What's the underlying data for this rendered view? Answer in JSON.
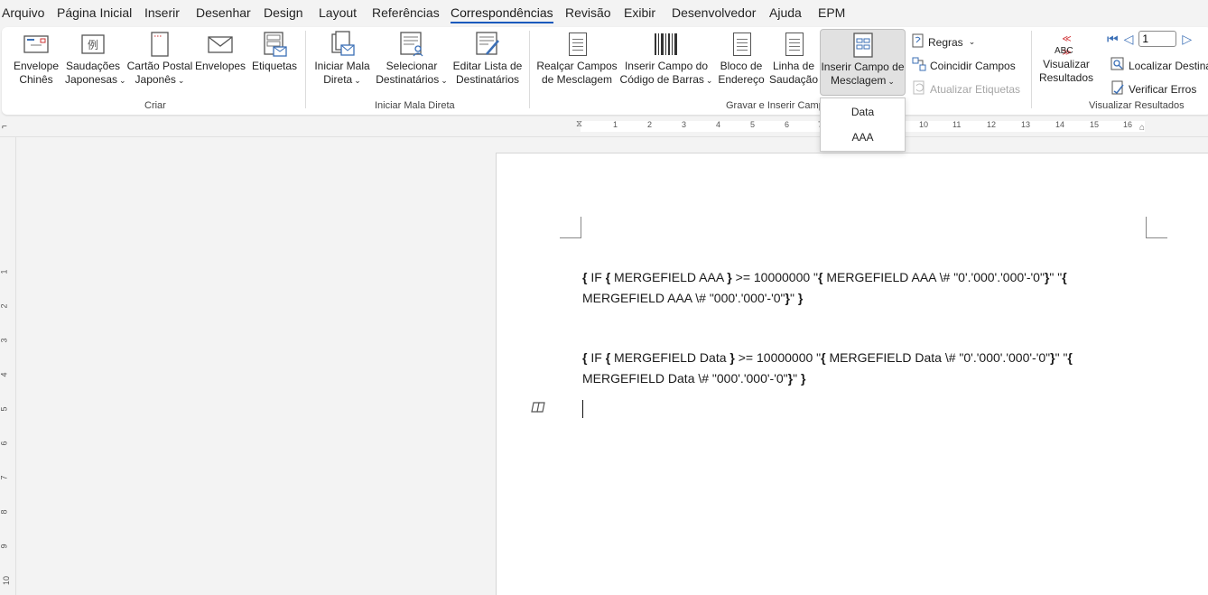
{
  "tabs": [
    "Arquivo",
    "Página Inicial",
    "Inserir",
    "Desenhar",
    "Design",
    "Layout",
    "Referências",
    "Correspondências",
    "Revisão",
    "Exibir",
    "Desenvolvedor",
    "Ajuda",
    "EPM"
  ],
  "active_tab": "Correspondências",
  "ribbon": {
    "criar": {
      "group_label": "Criar",
      "envelope_chines": [
        "Envelope",
        "Chinês"
      ],
      "saudacoes": [
        "Saudações",
        "Japonesas"
      ],
      "cartao": [
        "Cartão Postal",
        "Japonês"
      ],
      "envelopes": "Envelopes",
      "etiquetas": "Etiquetas"
    },
    "iniciar": {
      "group_label": "Iniciar Mala Direta",
      "iniciar_mala": [
        "Iniciar Mala",
        "Direta"
      ],
      "selecionar": [
        "Selecionar",
        "Destinatários"
      ],
      "editar": [
        "Editar Lista de",
        "Destinatários"
      ]
    },
    "gravar": {
      "group_label": "Gravar e Inserir Camp",
      "realcar": [
        "Realçar Campos",
        "de Mesclagem"
      ],
      "codigo_barras": [
        "Inserir Campo do",
        "Código de Barras"
      ],
      "bloco": [
        "Bloco de",
        "Endereço"
      ],
      "linha": [
        "Linha de",
        "Saudação"
      ],
      "inserir_campo": [
        "Inserir Campo de",
        "Mesclagem"
      ],
      "regras": "Regras",
      "coincidir": "Coincidir Campos",
      "atualizar": "Atualizar Etiquetas"
    },
    "visualizar": {
      "group_label": "Visualizar Resultados",
      "abc": "ABC",
      "visualizar": [
        "Visualizar",
        "Resultados"
      ],
      "record_value": "1",
      "localizar": "Localizar Destina",
      "verificar": "Verificar Erros"
    }
  },
  "merge_dropdown": [
    "Data",
    "AAA"
  ],
  "ruler_numbers": [
    "1",
    "2",
    "3",
    "4",
    "5",
    "6",
    "7",
    "10",
    "11",
    "12",
    "13",
    "14",
    "15",
    "16"
  ],
  "vruler_numbers": [
    "1",
    "2",
    "3",
    "4",
    "5",
    "6",
    "7",
    "8",
    "9",
    "10"
  ],
  "document": {
    "line1a": "{ IF { MERGEFIELD AAA } >= 10000000 \"{ MERGEFIELD AAA \\# \"0'.'000'.'000'-'0\"}\" \"{",
    "line1b": "MERGEFIELD AAA \\# \"000'.'000'-'0\"}\" }",
    "line2a": "{ IF { MERGEFIELD Data } >= 10000000 \"{ MERGEFIELD Data \\# \"0'.'000'.'000'-'0\"}\" \"{",
    "line2b": "MERGEFIELD Data \\# \"000'.'000'-'0\"}\" }"
  },
  "colors": {
    "accent": "#185abd",
    "ribbon_bg": "#ffffff",
    "app_bg": "#f3f3f3"
  }
}
